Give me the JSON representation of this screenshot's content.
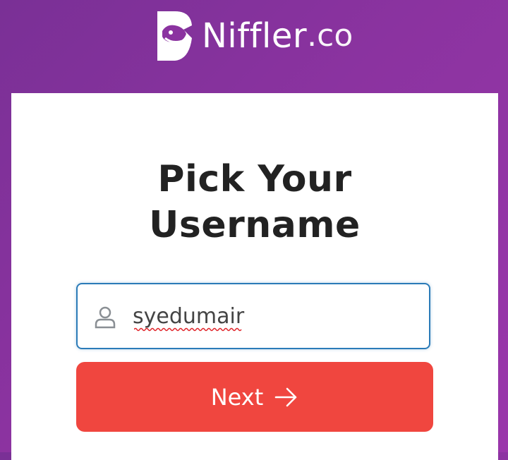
{
  "brand": {
    "name": "Niffler",
    "tld": ".co"
  },
  "page": {
    "title_line1": "Pick Your",
    "title_line2": "Username"
  },
  "form": {
    "username_value": "syedumair",
    "user_icon": "user-icon",
    "next_label": "Next",
    "next_icon": "arrow-right-icon"
  },
  "colors": {
    "background_gradient_start": "#7a3096",
    "background_gradient_end": "#9a36ab",
    "button": "#f0463f",
    "input_border": "#2b7bb8",
    "title_text": "#222222"
  }
}
